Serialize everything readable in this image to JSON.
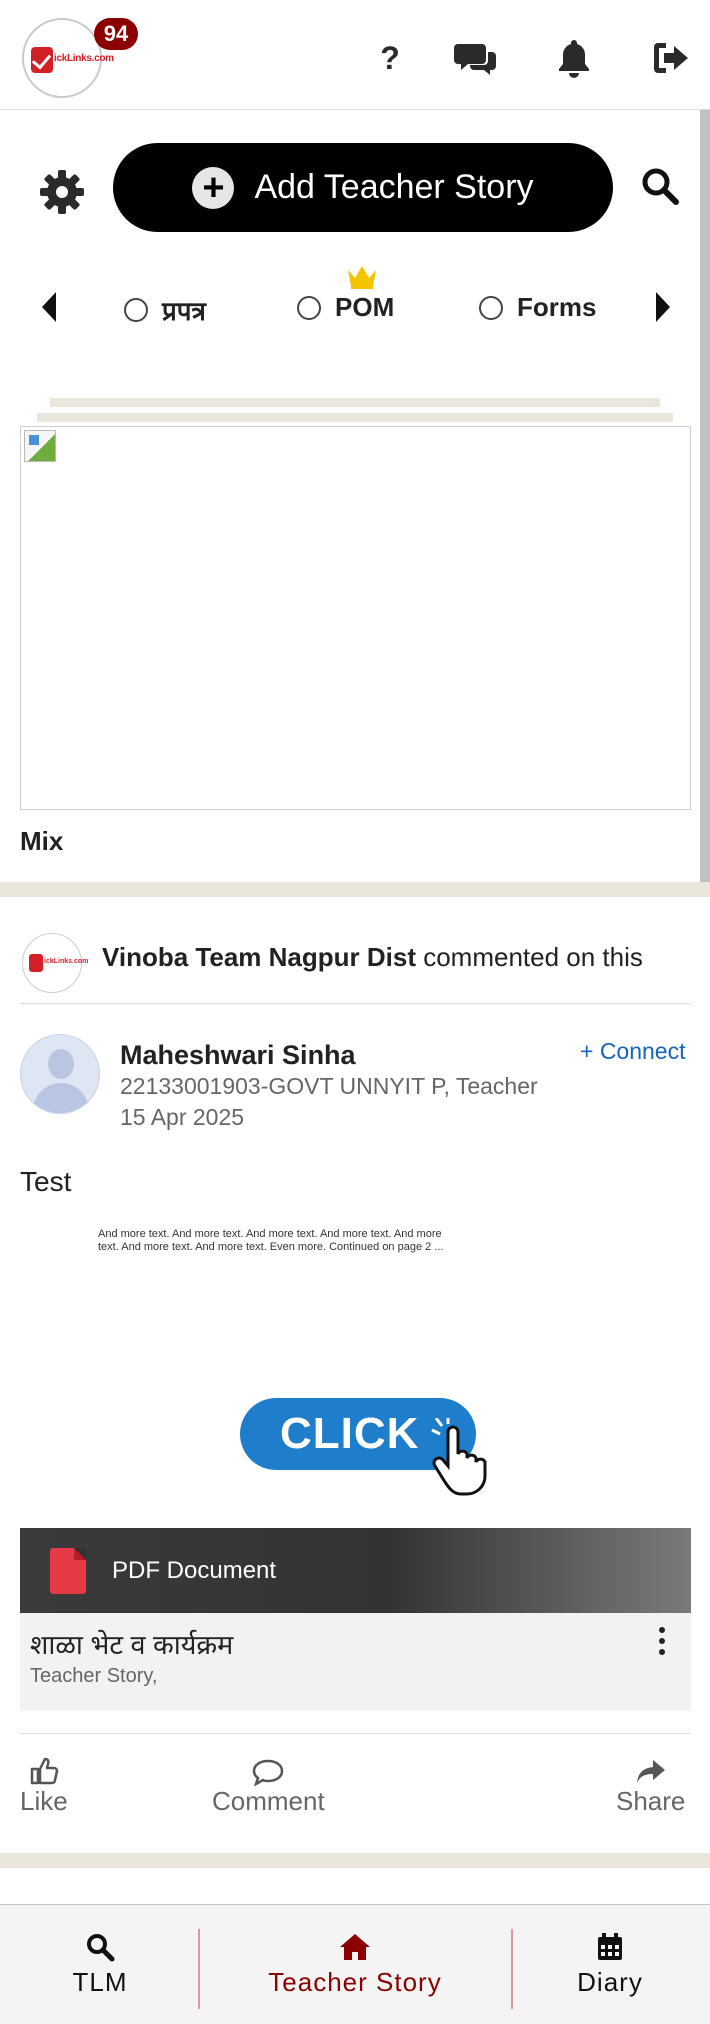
{
  "header": {
    "logo_text": "ickLinks.com",
    "notification_count": "94",
    "help_glyph": "?",
    "icons": [
      "help-icon",
      "chat-icon",
      "bell-icon",
      "logout-icon"
    ]
  },
  "toolbar": {
    "add_story_label": "Add Teacher Story",
    "settings_icon": "gear-icon",
    "search_icon": "search-icon"
  },
  "filters": {
    "items": [
      {
        "label": "प्रपत्र"
      },
      {
        "label": "POM",
        "premium": true
      },
      {
        "label": "Forms"
      }
    ]
  },
  "featured": {
    "category_label": "Mix"
  },
  "post": {
    "activity_actor": "Vinoba Team Nagpur Dist",
    "activity_text": "commented on this",
    "activity_logo_text": "ickLinks.com",
    "author_name": "Maheshwari Sinha",
    "author_detail": "22133001903-GOVT UNNYIT P, Teacher",
    "date": "15 Apr 2025",
    "connect_label": "+ Connect",
    "body_text": "Test",
    "preview_line1": "And more text. And more text. And more text. And more text. And more",
    "preview_line2": "text. And more text. And more text. Even more. Continued on page 2 ...",
    "click_label": "CLICK",
    "attachment_type": "PDF Document",
    "doc_title": "शाळा भेट व कार्यक्रम",
    "doc_subtitle": "Teacher Story,"
  },
  "actions": {
    "like": "Like",
    "comment": "Comment",
    "share": "Share"
  },
  "bottom_nav": {
    "items": [
      {
        "label": "TLM",
        "icon": "search-icon",
        "active": false
      },
      {
        "label": "Teacher Story",
        "icon": "home-icon",
        "active": true
      },
      {
        "label": "Diary",
        "icon": "calendar-icon",
        "active": false
      }
    ]
  },
  "colors": {
    "brand_red": "#d31f26",
    "badge": "#8b0000",
    "active_nav": "#8b0000",
    "link_blue": "#1565c0",
    "divider": "#eae6dc"
  }
}
